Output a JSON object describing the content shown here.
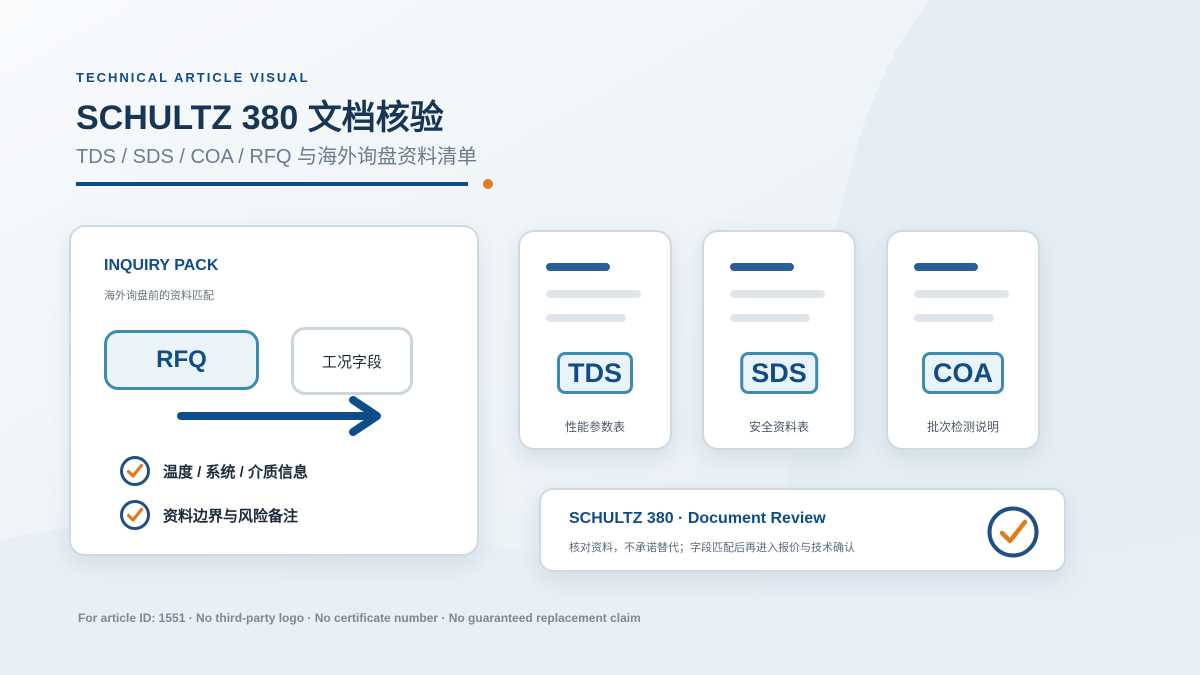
{
  "header": {
    "kicker": "TECHNICAL ARTICLE VISUAL",
    "title": "SCHULTZ 380 文档核验",
    "subtitle": "TDS / SDS / COA / RFQ 与海外询盘资料清单"
  },
  "inquiry_pack": {
    "title": "INQUIRY PACK",
    "subtitle": "海外询盘前的资料匹配",
    "source_label": "RFQ",
    "target_label": "工况字段",
    "checklist": [
      "温度 / 系统 / 介质信息",
      "资料边界与风险备注"
    ]
  },
  "documents": [
    {
      "badge": "TDS",
      "caption": "性能参数表"
    },
    {
      "badge": "SDS",
      "caption": "安全资料表"
    },
    {
      "badge": "COA",
      "caption": "批次检测说明"
    }
  ],
  "review": {
    "title": "SCHULTZ 380 · Document Review",
    "subtitle": "核对资料，不承诺替代；字段匹配后再进入报价与技术确认"
  },
  "footer": "For article ID: 1551 · No third-party logo · No certificate number · No guaranteed replacement claim",
  "colors": {
    "brand_blue": "#0f4c8a",
    "accent_orange": "#e07b24",
    "badge_border": "#3d8bb0",
    "heading_dark": "#173554"
  }
}
